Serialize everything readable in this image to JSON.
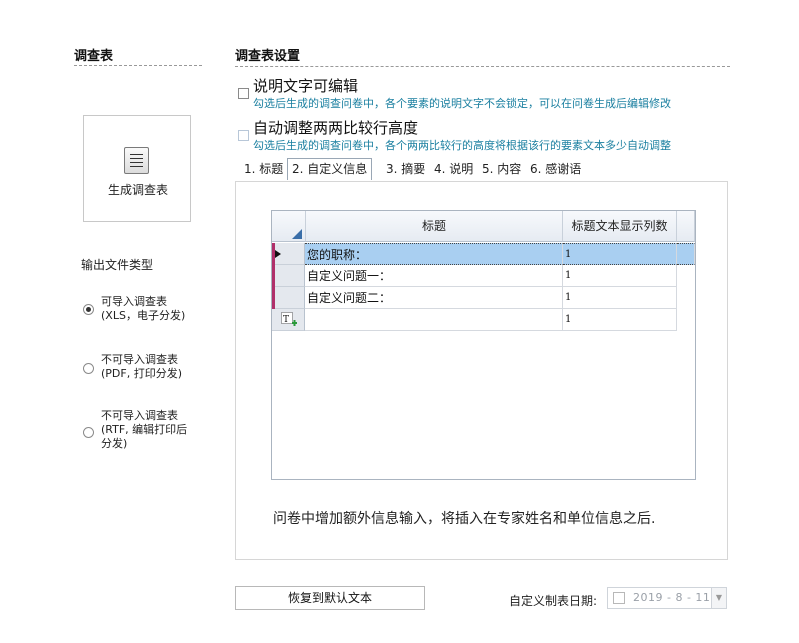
{
  "left_panel": {
    "title": "调查表",
    "generate_button": "生成调查表",
    "output_type_label": "输出文件类型",
    "options": [
      {
        "line1": "可导入调查表",
        "line2": "(XLS，电子分发)",
        "line3": "",
        "selected": true
      },
      {
        "line1": "不可导入调查表",
        "line2": "(PDF, 打印分发)",
        "line3": "",
        "selected": false
      },
      {
        "line1": "不可导入调查表",
        "line2": "(RTF, 编辑打印后",
        "line3": "分发)",
        "selected": false
      }
    ]
  },
  "settings": {
    "title": "调查表设置",
    "option1": {
      "title": "说明文字可编辑",
      "desc": "勾选后生成的调查问卷中，各个要素的说明文字不会锁定，可以在问卷生成后编辑修改",
      "checked": false
    },
    "option2": {
      "title": "自动调整两两比较行高度",
      "desc": "勾选后生成的调查问卷中，各个两两比较行的高度将根据该行的要素文本多少自动调整",
      "checked": false
    }
  },
  "tabs": [
    {
      "label": "1. 标题",
      "active": false
    },
    {
      "label": "2. 自定义信息",
      "active": true
    },
    {
      "label": "3. 摘要",
      "active": false
    },
    {
      "label": "4. 说明",
      "active": false
    },
    {
      "label": "5. 内容",
      "active": false
    },
    {
      "label": "6. 感谢语",
      "active": false
    }
  ],
  "grid": {
    "columns": [
      "标题",
      "标题文本显示列数"
    ],
    "rows": [
      {
        "title": "您的职称：",
        "cols": "1"
      },
      {
        "title": "自定义问题一：",
        "cols": "1"
      },
      {
        "title": "自定义问题二：",
        "cols": "1"
      },
      {
        "title": "",
        "cols": "1"
      }
    ]
  },
  "footnote": "问卷中增加额外信息输入，将插入在专家姓名和单位信息之后.",
  "reset_button": "恢复到默认文本",
  "date": {
    "label": "自定义制表日期:",
    "value": "2019 - 8 - 11"
  },
  "colors": {
    "accent_text": "#1a7fa0",
    "selection": "#a9cff1",
    "row_marker": "#b0306a"
  }
}
